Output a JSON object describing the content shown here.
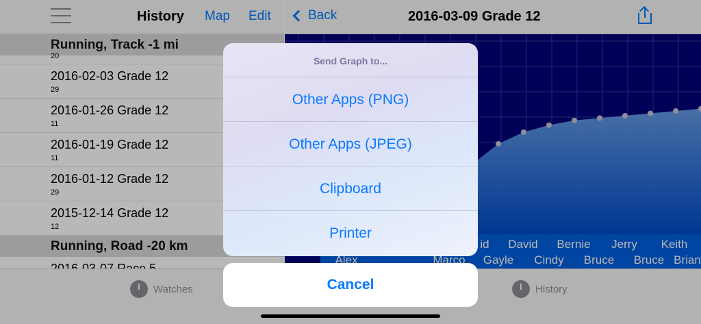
{
  "left_pane": {
    "nav": {
      "title": "History",
      "map_label": "Map",
      "edit_label": "Edit",
      "menu_icon": "hamburger-menu-icon"
    },
    "sections": [
      {
        "header": "Running, Track -1 mi",
        "rows": [
          {
            "title": "",
            "subtitle": "20"
          },
          {
            "title": "2016-02-03 Grade 12",
            "subtitle": "29"
          },
          {
            "title": "2016-01-26 Grade 12",
            "subtitle": "11"
          },
          {
            "title": "2016-01-19 Grade 12",
            "subtitle": "11"
          },
          {
            "title": "2016-01-12 Grade 12",
            "subtitle": "29"
          },
          {
            "title": "2015-12-14 Grade 12",
            "subtitle": "12"
          }
        ]
      },
      {
        "header": "Running, Road -20 km",
        "rows": [
          {
            "title": "2016-03-07 Race 5",
            "subtitle": ""
          }
        ]
      }
    ]
  },
  "right_pane": {
    "nav": {
      "back_label": "Back",
      "title": "2016-03-09 Grade 12",
      "share_icon": "share-icon"
    }
  },
  "chart_data": {
    "type": "area",
    "points_y_relative": [
      0.57,
      0.52,
      0.49,
      0.47,
      0.46,
      0.45,
      0.44,
      0.43,
      0.42
    ],
    "x_labels_row1": [
      "id",
      "David",
      "Bernie",
      "Jerry",
      "Keith"
    ],
    "x_labels_row2": [
      "Alex",
      "Marco",
      "Gayle",
      "Cindy",
      "Bruce",
      "Bruce",
      "Brian"
    ],
    "colors": {
      "background": "#00007a",
      "fill_top": "#6aa3ea",
      "fill_bottom": "#0050d0",
      "points": "#c7c7d6",
      "grid": "#3a3a9c"
    }
  },
  "tabbar": {
    "watches_label": "Watches",
    "history_label": "History",
    "watches_icon": "stopwatch-icon",
    "history_icon": "clock-icon"
  },
  "action_sheet": {
    "title": "Send Graph to...",
    "options": [
      "Other Apps (PNG)",
      "Other Apps (JPEG)",
      "Clipboard",
      "Printer"
    ],
    "cancel_label": "Cancel"
  },
  "colors": {
    "accent": "#007aff",
    "sheet_button": "#0a7aff"
  }
}
